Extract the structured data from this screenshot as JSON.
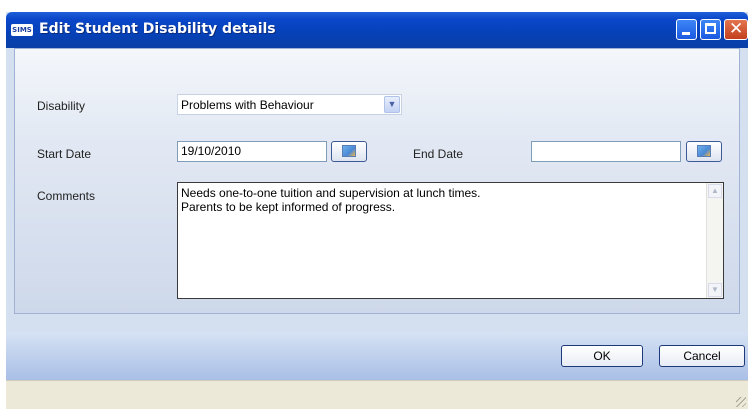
{
  "window": {
    "title": "Edit Student Disability details",
    "app_icon": "SIMS"
  },
  "form": {
    "disability_label": "Disability",
    "disability_value": "Problems with Behaviour",
    "start_date_label": "Start Date",
    "start_date_value": "19/10/2010",
    "end_date_label": "End Date",
    "end_date_value": "",
    "comments_label": "Comments",
    "comments_value": "Needs one-to-one tuition and supervision at lunch times.\nParents to be kept informed of progress."
  },
  "buttons": {
    "ok": "OK",
    "cancel": "Cancel"
  },
  "icons": {
    "minimize": "minimize-icon",
    "maximize": "maximize-icon",
    "close": "close-icon",
    "calendar": "calendar-icon",
    "dropdown": "chevron-down-icon"
  },
  "colors": {
    "titlebar": "#0a47c9",
    "panel": "#d4dfef",
    "close_button": "#c23f1d"
  }
}
